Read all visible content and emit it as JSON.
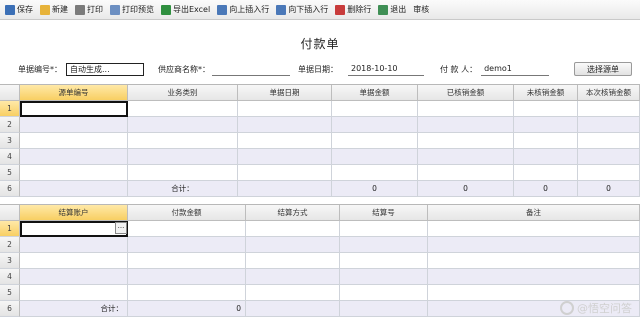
{
  "toolbar": {
    "buttons": [
      {
        "label": "保存",
        "icon": "save-icon",
        "color": "#3b6fb6"
      },
      {
        "label": "新建",
        "icon": "new-doc-icon",
        "color": "#e7b33a"
      },
      {
        "label": "打印",
        "icon": "print-icon",
        "color": "#7a7a7a"
      },
      {
        "label": "打印预览",
        "icon": "print-preview-icon",
        "color": "#6c8fc2"
      },
      {
        "label": "导出Excel",
        "icon": "excel-icon",
        "color": "#2f8f3f"
      },
      {
        "label": "向上插入行",
        "icon": "insert-row-above-icon",
        "color": "#4a78b8"
      },
      {
        "label": "向下插入行",
        "icon": "insert-row-below-icon",
        "color": "#4a78b8"
      },
      {
        "label": "删除行",
        "icon": "delete-row-icon",
        "color": "#c83b3b"
      },
      {
        "label": "退出",
        "icon": "exit-icon",
        "color": "#3f8f55"
      },
      {
        "label": "审核",
        "icon": "",
        "color": ""
      }
    ]
  },
  "form": {
    "title": "付款单",
    "doc_no_label": "单据编号*：",
    "doc_no_value": "自动生成...",
    "supplier_label": "供应商名称*：",
    "supplier_value": "",
    "date_label": "单据日期：",
    "date_value": "2018-10-10",
    "payer_label": "付 款 人：",
    "payer_value": "demo1",
    "select_source_label": "选择源单"
  },
  "grid1": {
    "columns": [
      "源单编号",
      "业务类别",
      "单据日期",
      "单据金额",
      "已核销金额",
      "未核销金额",
      "本次核销金额"
    ],
    "row_numbers": [
      "1",
      "2",
      "3",
      "4",
      "5",
      "6"
    ],
    "total_label": "合计：",
    "totals": [
      "0",
      "0",
      "0",
      "0"
    ]
  },
  "grid2": {
    "columns": [
      "结算账户",
      "付款金额",
      "结算方式",
      "结算号",
      "备注"
    ],
    "row_numbers": [
      "1",
      "2",
      "3",
      "4",
      "5",
      "6"
    ],
    "total_label": "合计：",
    "total_amount": "0",
    "ellipsis": "···"
  },
  "watermark": "@悟空问答"
}
